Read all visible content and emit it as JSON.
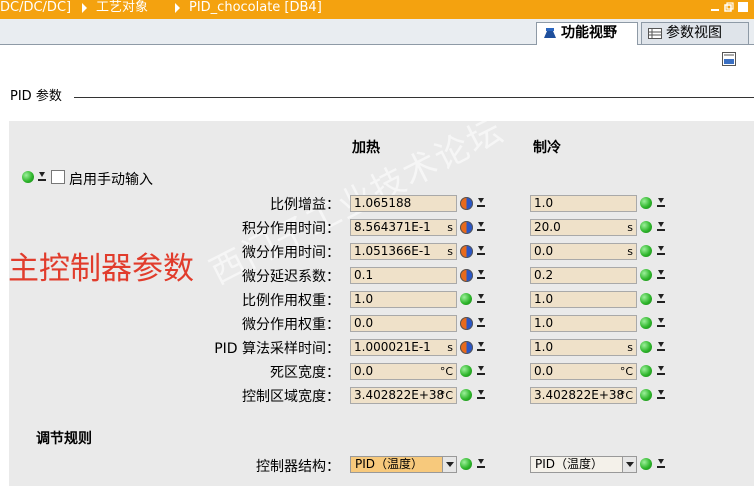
{
  "breadcrumb": {
    "items": [
      "DC/DC/DC]",
      "工艺对象",
      "PID_chocolate [DB4]"
    ]
  },
  "tabs": [
    {
      "label": "功能视野",
      "icon": "function-view-icon"
    },
    {
      "label": "参数视图",
      "icon": "parameter-view-icon"
    }
  ],
  "section_title": "PID 参数",
  "columns": {
    "heat": "加热",
    "cool": "制冷"
  },
  "manual_input_label": "启用手动输入",
  "params": [
    {
      "label": "比例增益：",
      "heat": "1.065188",
      "heat_unit": "",
      "cool": "1.0",
      "cool_unit": ""
    },
    {
      "label": "积分作用时间：",
      "heat": "8.564371E-1",
      "heat_unit": "s",
      "cool": "20.0",
      "cool_unit": "s"
    },
    {
      "label": "微分作用时间：",
      "heat": "1.051366E-1",
      "heat_unit": "s",
      "cool": "0.0",
      "cool_unit": "s"
    },
    {
      "label": "微分延迟系数：",
      "heat": "0.1",
      "heat_unit": "",
      "cool": "0.2",
      "cool_unit": ""
    },
    {
      "label": "比例作用权重：",
      "heat": "1.0",
      "heat_unit": "",
      "cool": "1.0",
      "cool_unit": ""
    },
    {
      "label": "微分作用权重：",
      "heat": "0.0",
      "heat_unit": "",
      "cool": "1.0",
      "cool_unit": ""
    },
    {
      "label": "PID 算法采样时间：",
      "heat": "1.000021E-1",
      "heat_unit": "s",
      "cool": "1.0",
      "cool_unit": "s"
    },
    {
      "label": "死区宽度：",
      "heat": "0.0",
      "heat_unit": "°C",
      "cool": "0.0",
      "cool_unit": "°C"
    },
    {
      "label": "控制区域宽度：",
      "heat": "3.402822E+38",
      "heat_unit": "°C",
      "cool": "3.402822E+38",
      "cool_unit": "°C"
    }
  ],
  "overlay_text": "主控制器参数",
  "watermark": "西门子工业技术论坛",
  "control_rules": {
    "title": "调节规则",
    "structure_label": "控制器结构：",
    "heat_value": "PID（温度）",
    "cool_value": "PID（温度）"
  },
  "colors": {
    "titlebar": "#f4a20f",
    "field_bg": "#efe1c9",
    "panel_bg": "#eaeaea",
    "overlay_red": "#e13c2c"
  }
}
